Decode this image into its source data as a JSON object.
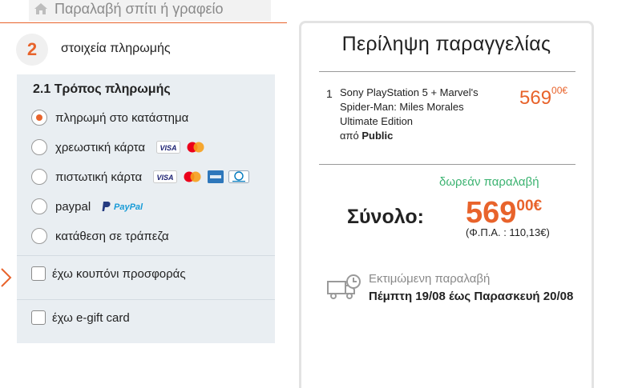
{
  "top": {
    "title": "Παραλαβή σπίτι ή γραφείο",
    "icon": "home-icon"
  },
  "step": {
    "number": "2",
    "label": "στοιχεία πληρωμής"
  },
  "payment": {
    "title": "2.1 Τρόπος πληρωμής",
    "options": [
      {
        "label": "πληρωμή στο κατάστημα",
        "selected": true,
        "logos": []
      },
      {
        "label": "χρεωστική κάρτα",
        "selected": false,
        "logos": [
          "visa",
          "mastercard"
        ]
      },
      {
        "label": "πιστωτική κάρτα",
        "selected": false,
        "logos": [
          "visa",
          "mastercard",
          "amex",
          "diners"
        ]
      },
      {
        "label": "paypal",
        "selected": false,
        "logos": [
          "paypal"
        ]
      },
      {
        "label": "κατάθεση σε τράπεζα",
        "selected": false,
        "logos": []
      }
    ],
    "paypal_logo_text": "PayPal",
    "visa_text": "VISA",
    "checks": [
      {
        "label": "έχω κουπόνι προσφοράς",
        "checked": false
      },
      {
        "label": "έχω e-gift card",
        "checked": false
      }
    ],
    "accent_color": "#e8632b",
    "panel_color": "#e9eef2"
  },
  "summary": {
    "title": "Περίληψη παραγγελίας",
    "item": {
      "quantity": "1",
      "name": "Sony PlayStation 5 + Marvel's Spider-Man: Miles Morales Ultimate Edition",
      "seller_prefix": "από",
      "seller": "Public",
      "price_main": "569",
      "price_cents": "00€"
    },
    "free_shipping": "δωρεάν παραλαβή",
    "total_label": "Σύνολο:",
    "total_main": "569",
    "total_cents": "00€",
    "vat": "(Φ.Π.Α. : 110,13€)",
    "estimate_label": "Εκτιμώμενη παραλαβή",
    "estimate_dates": "Πέμπτη 19/08 έως Παρασκευή 20/08",
    "price_color": "#e8632b",
    "free_shipping_color": "#3cb371"
  }
}
